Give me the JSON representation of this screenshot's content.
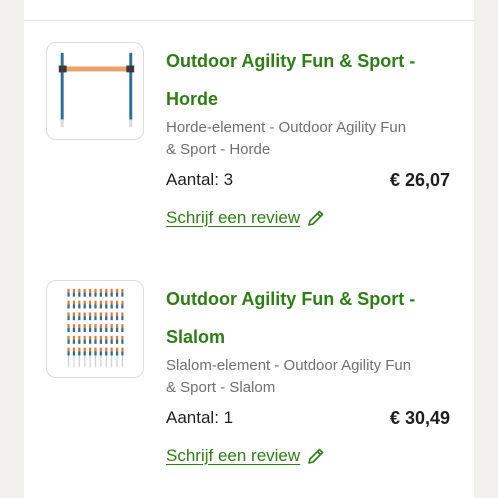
{
  "order_items": [
    {
      "title_line1": "Outdoor Agility Fun & Sport -",
      "title_line2": "Horde",
      "subtitle_line1": "Horde-element - Outdoor Agility Fun",
      "subtitle_line2": "& Sport - Horde",
      "quantity": "Aantal: 3",
      "price": "€ 26,07",
      "review_label": "Schrijf een review",
      "image_icon": "agility-hurdle"
    },
    {
      "title_line1": "Outdoor Agility Fun & Sport -",
      "title_line2": "Slalom",
      "subtitle_line1": "Slalom-element - Outdoor Agility Fun",
      "subtitle_line2": "& Sport - Slalom",
      "quantity": "Aantal: 1",
      "price": "€ 30,49",
      "review_label": "Schrijf een review",
      "image_icon": "agility-slalom-poles"
    }
  ],
  "colors": {
    "accent_green": "#2f7d15",
    "text_dark": "#1f1f1f",
    "text_muted": "#707070",
    "background": "#f2f1ee"
  }
}
